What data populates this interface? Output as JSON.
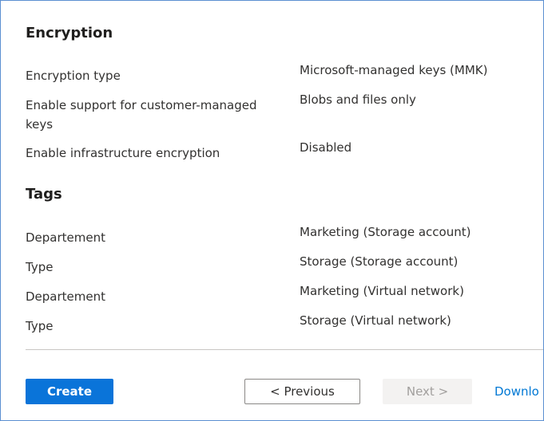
{
  "encryption": {
    "title": "Encryption",
    "rows": [
      {
        "label": "Encryption type",
        "value": "Microsoft-managed keys (MMK)"
      },
      {
        "label": "Enable support for customer-managed keys",
        "value": "Blobs and files only"
      },
      {
        "label": "Enable infrastructure encryption",
        "value": "Disabled"
      }
    ]
  },
  "tags": {
    "title": "Tags",
    "rows": [
      {
        "label": "Departement",
        "value": "Marketing (Storage account)"
      },
      {
        "label": "Type",
        "value": "Storage (Storage account)"
      },
      {
        "label": "Departement",
        "value": "Marketing (Virtual network)"
      },
      {
        "label": "Type",
        "value": "Storage (Virtual network)"
      }
    ]
  },
  "footer": {
    "create_label": "Create",
    "previous_label": "< Previous",
    "next_label": "Next >",
    "download_label": "Downlo"
  },
  "colors": {
    "primary": "#0a74d9",
    "link": "#0078d4",
    "border": "#5b8fd1"
  }
}
